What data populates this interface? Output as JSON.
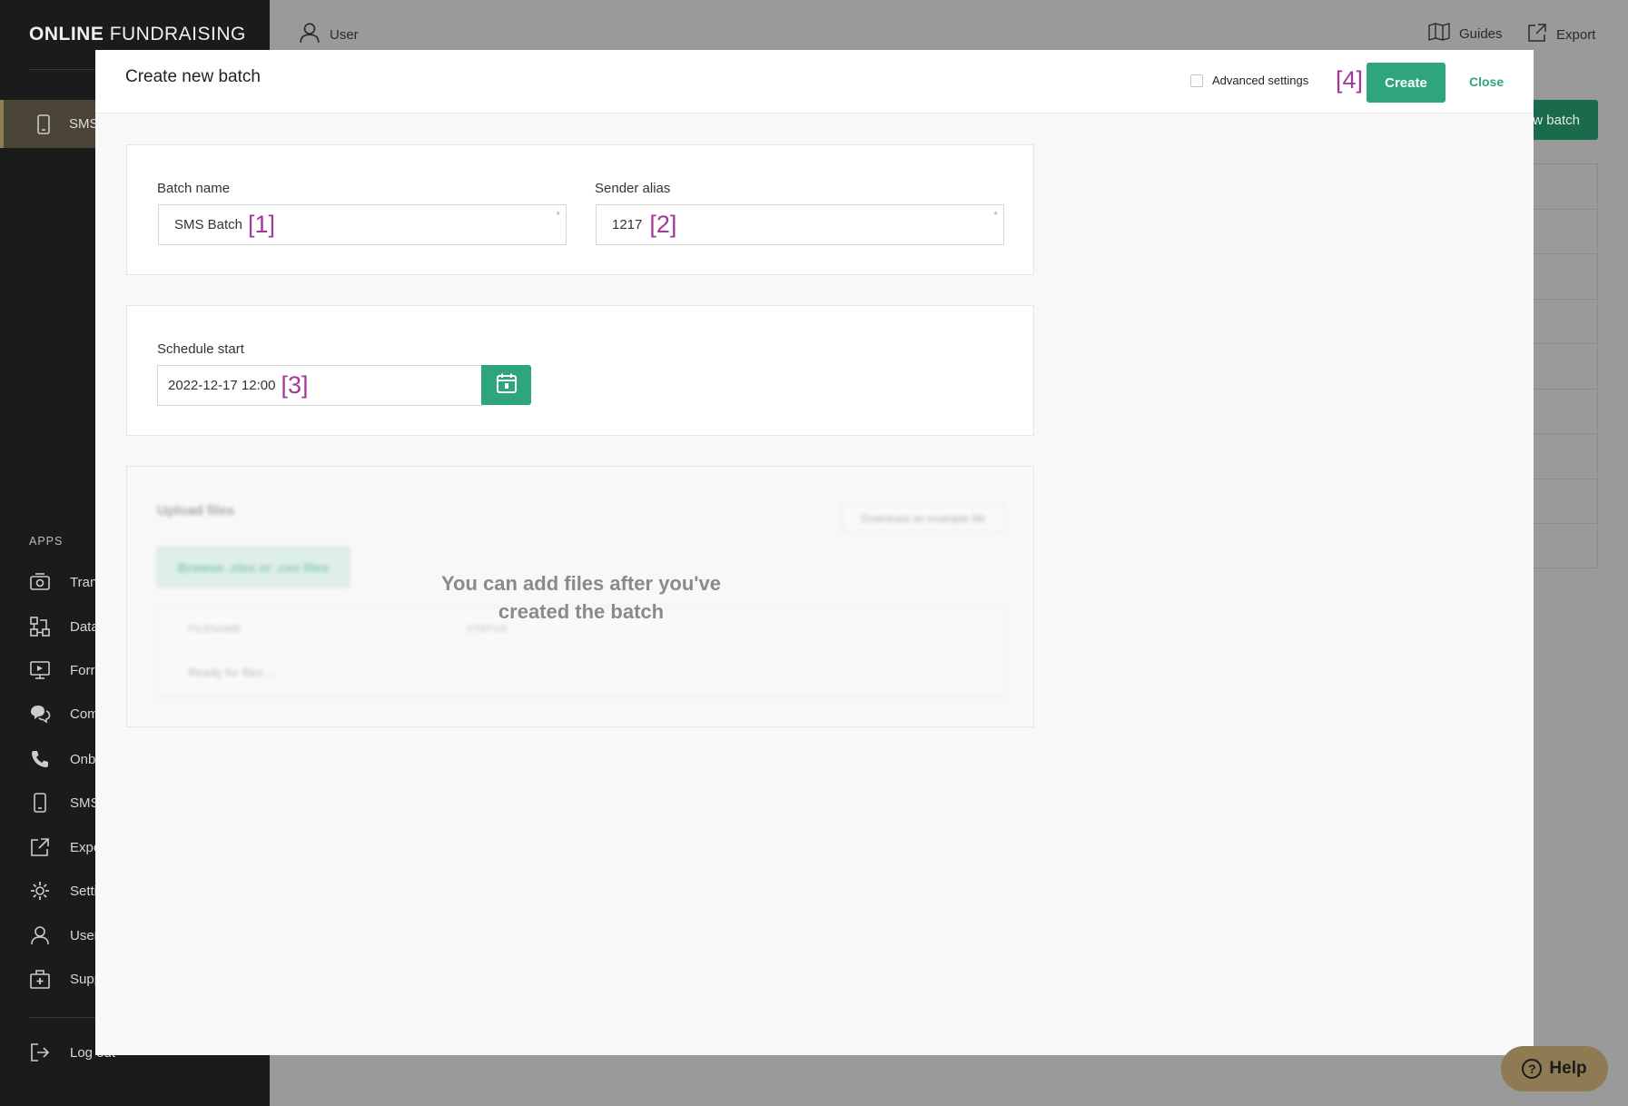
{
  "sidebar": {
    "logo_bold": "ONLINE",
    "logo_light": "FUNDRAISING",
    "active_item": {
      "label": "SMS",
      "icon": "phone-icon"
    },
    "apps_heading": "APPS",
    "items": [
      {
        "label": "Tran",
        "icon": "camera-money-icon"
      },
      {
        "label": "Data",
        "icon": "flowchart-icon"
      },
      {
        "label": "Forr",
        "icon": "monitor-icon"
      },
      {
        "label": "Com",
        "icon": "chat-icon"
      },
      {
        "label": "Onb",
        "icon": "phone-call-icon"
      },
      {
        "label": "SMS",
        "icon": "phone-icon"
      },
      {
        "label": "Expo",
        "icon": "export-icon"
      },
      {
        "label": "Setti",
        "icon": "gear-icon"
      },
      {
        "label": "User",
        "icon": "user-icon"
      },
      {
        "label": "Supp",
        "icon": "medkit-icon"
      }
    ],
    "logout_label": "Log out"
  },
  "topbar": {
    "user_label": "User",
    "guides_label": "Guides",
    "export_label": "Export",
    "new_batch_label": "w batch"
  },
  "modal": {
    "title": "Create new batch",
    "advanced_settings_label": "Advanced settings",
    "create_label": "Create",
    "close_label": "Close",
    "marker_create": "[4]",
    "batch_name": {
      "label": "Batch name",
      "value": "SMS Batch",
      "marker": "[1]",
      "required": "*"
    },
    "sender_alias": {
      "label": "Sender alias",
      "value": "1217",
      "marker": "[2]",
      "required": "*"
    },
    "schedule": {
      "label": "Schedule start",
      "value": "2022-12-17 12:00",
      "marker": "[3]"
    },
    "upload": {
      "heading": "Upload files",
      "download_example": "Download an example file",
      "browse_label": "Browse .xlsx or .csv files",
      "columns": [
        "FILENAME",
        "STATUS"
      ],
      "empty_row": "Ready for files ...",
      "overlay_message": "You can add files after you've created the batch"
    }
  },
  "help": {
    "label": "Help"
  },
  "colors": {
    "accent": "#2ea57a",
    "sidebar_bg": "#1b1b1b",
    "marker": "#a3389a"
  }
}
